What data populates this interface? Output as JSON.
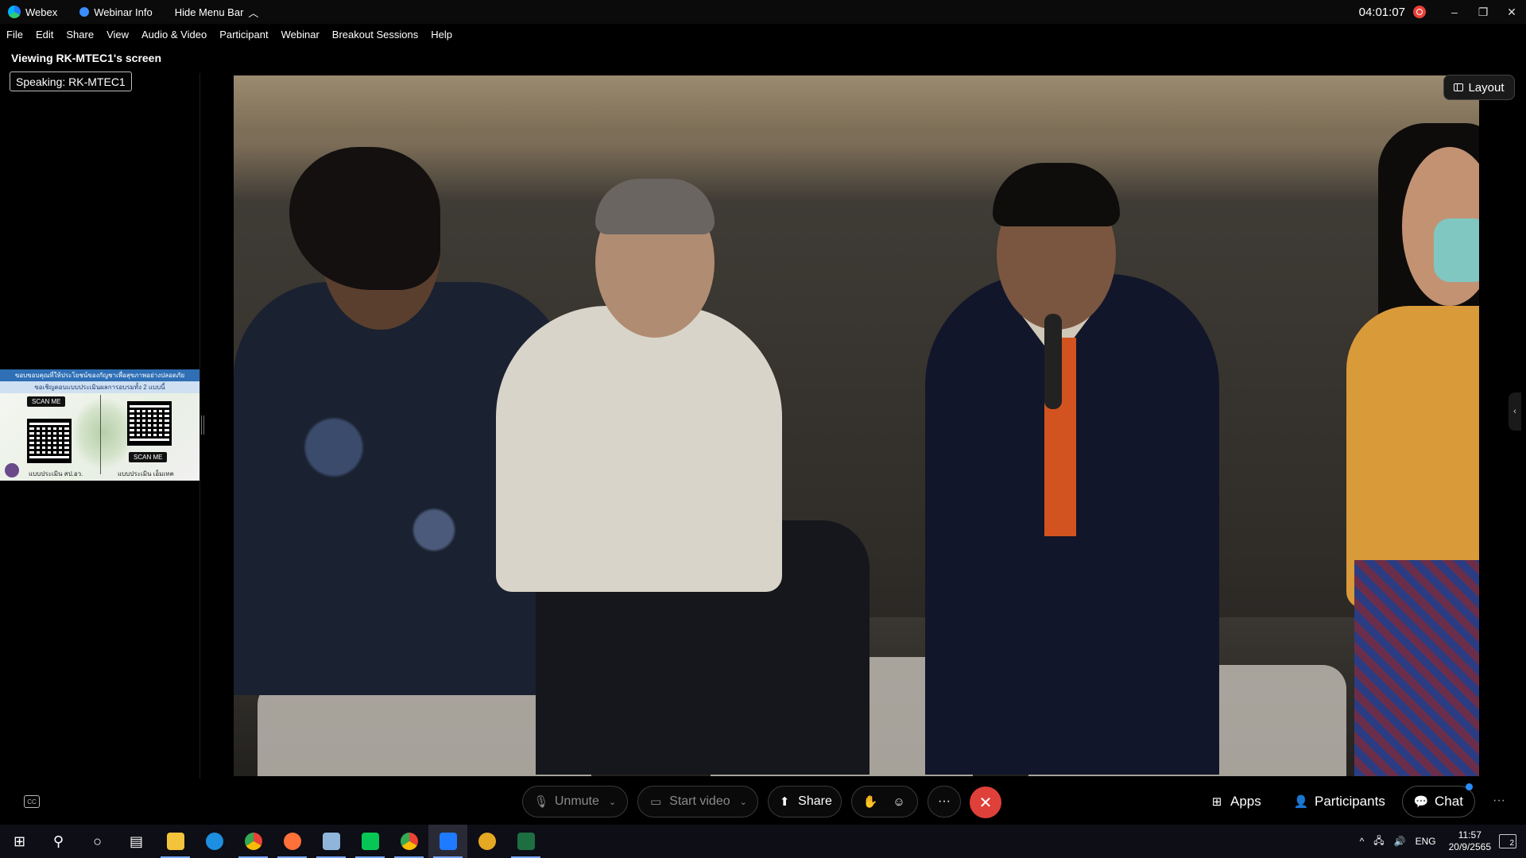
{
  "titlebar": {
    "app_name": "Webex",
    "webinar_info": "Webinar Info",
    "hide_menu": "Hide Menu Bar",
    "clock": "04:01:07",
    "minimize": "–",
    "restore": "❐",
    "close": "✕"
  },
  "menu": [
    "File",
    "Edit",
    "Share",
    "View",
    "Audio & Video",
    "Participant",
    "Webinar",
    "Breakout Sessions",
    "Help"
  ],
  "viewing": "Viewing RK-MTEC1's screen",
  "speaking": "Speaking: RK-MTEC1",
  "poster": {
    "line1": "ขอบขอบคุณที่ให้ประโยชน์ของกัญชาเพื่อสุขภาพอย่างปลอดภัย",
    "line2": "ขอเชิญตอบแบบประเมินผลการอบรมทั้ง 2 แบบนี้",
    "scan_label": "SCAN ME",
    "foot_left": "แบบประเมิน สป.อว.",
    "foot_right": "แบบประเมิน เอ็มเทค"
  },
  "video": {
    "layout_label": "Layout",
    "side_tab": "‹"
  },
  "controls": {
    "cc": "CC",
    "unmute": "Unmute",
    "start_video": "Start video",
    "share": "Share",
    "more": "···",
    "leave": "✕",
    "apps": "Apps",
    "participants": "Participants",
    "chat": "Chat",
    "overflow": "···"
  },
  "taskbar": {
    "lang": "ENG",
    "time": "11:57",
    "date": "20/9/2565",
    "notifications": "2"
  },
  "colors": {
    "leave_red": "#e0403a",
    "chat_dot": "#2a8cff",
    "record_red": "#e8403a"
  }
}
